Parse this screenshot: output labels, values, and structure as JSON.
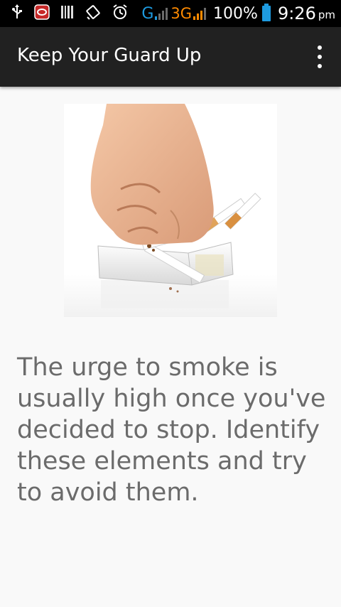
{
  "status_bar": {
    "icons": [
      "usb-icon",
      "app-notification-icon",
      "barcode-icon",
      "vibrate-icon",
      "alarm-icon"
    ],
    "network_g": "G",
    "network_3g": "3G",
    "battery_percent": "100%",
    "time": "9:26",
    "ampm": "pm"
  },
  "app_bar": {
    "title": "Keep Your Guard Up",
    "overflow_icon": "more-vert-icon"
  },
  "content": {
    "image_alt": "fist crushing cigarettes",
    "text": "The urge to smoke is usually high once you've decided to stop. Identify these elements and try to avoid them."
  },
  "colors": {
    "status_bar_bg": "#000000",
    "app_bar_bg": "#212121",
    "page_bg": "#f9f9f9",
    "text": "#6b6b6b",
    "accent_blue": "#1e9be0",
    "accent_orange": "#ff8a00"
  }
}
